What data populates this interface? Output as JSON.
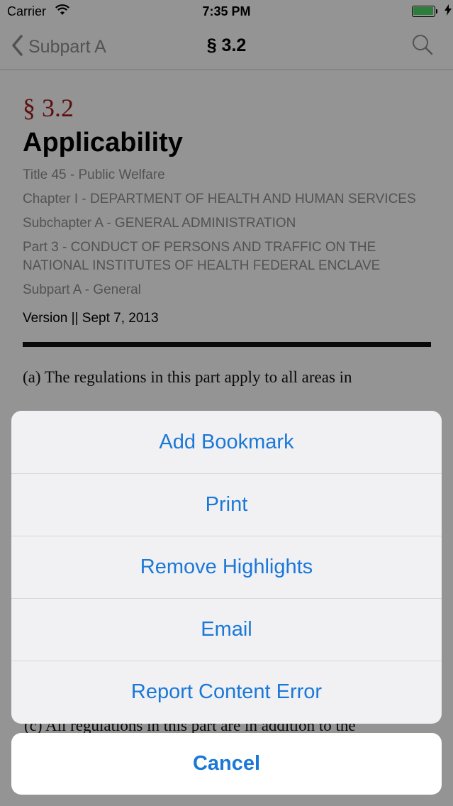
{
  "status_bar": {
    "carrier": "Carrier",
    "time": "7:35 PM"
  },
  "nav": {
    "back_label": "Subpart A",
    "title": "§ 3.2"
  },
  "content": {
    "section_number": "§ 3.2",
    "heading": "Applicability",
    "meta": [
      "Title 45 - Public Welfare",
      "Chapter I - DEPARTMENT OF HEALTH AND HUMAN SERVICES",
      "Subchapter A - GENERAL ADMINISTRATION",
      "Part 3 - CONDUCT OF PERSONS AND TRAFFIC ON THE NATIONAL INSTITUTES OF HEALTH FEDERAL ENCLAVE",
      "Subpart A - General"
    ],
    "version": "Version || Sept 7, 2013",
    "paragraph_a": "(a) The regulations in this part apply to all areas in",
    "paragraph_c": "(c) All regulations in this part are in addition to the"
  },
  "action_sheet": {
    "actions": [
      "Add Bookmark",
      "Print",
      "Remove Highlights",
      "Email",
      "Report Content Error"
    ],
    "cancel": "Cancel"
  },
  "colors": {
    "accent": "#1a78d8",
    "section_red": "#a21d1d",
    "battery_green": "#4cd964"
  }
}
